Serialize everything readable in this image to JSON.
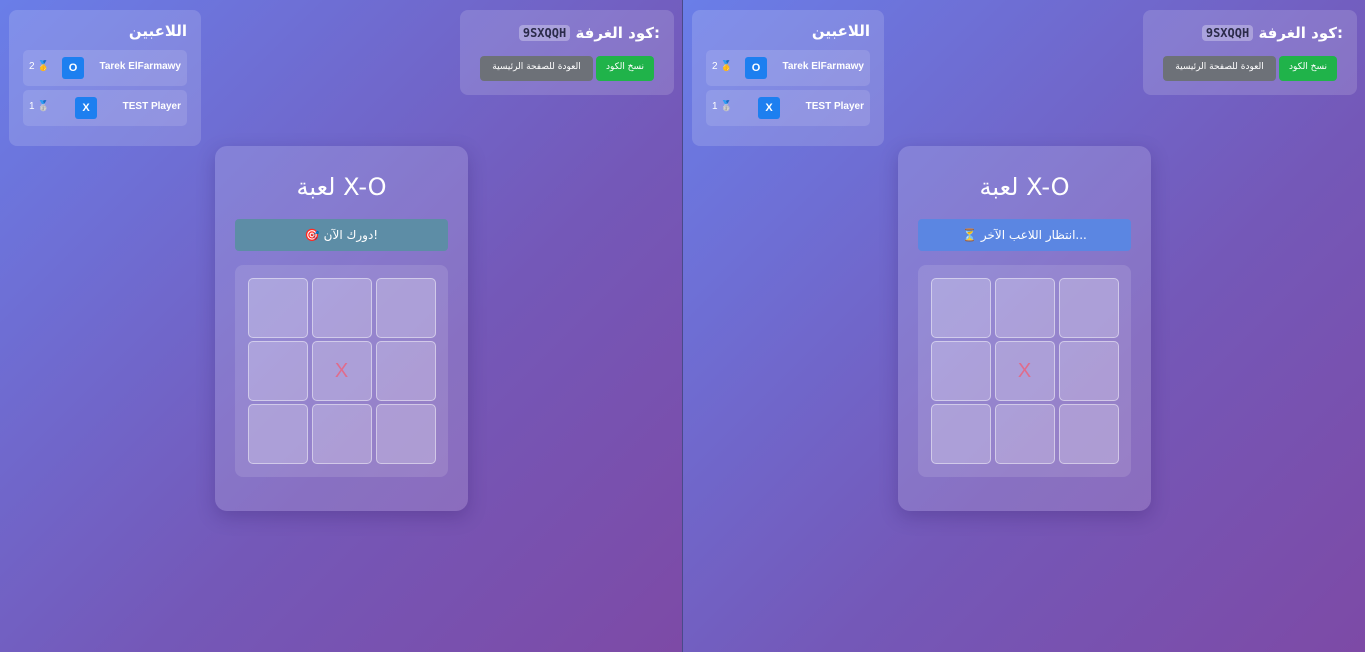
{
  "panes": [
    {
      "players": {
        "title": "اللاعبين",
        "list": [
          {
            "name": "Tarek ElFarmawy",
            "symbol": "O",
            "score": "2 🥇"
          },
          {
            "name": "TEST Player",
            "symbol": "X",
            "score": "1 🥈"
          }
        ]
      },
      "room": {
        "label": "كود الغرفة:",
        "code": "9SXQQH",
        "copy_label": "نسخ الكود",
        "home_label": "العودة للصفحة الرئيسية"
      },
      "game": {
        "title": "لعبة X-O",
        "status": "🎯 دورك الآن!",
        "board": [
          "",
          "",
          "",
          "",
          "X",
          "",
          "",
          "",
          ""
        ]
      }
    },
    {
      "players": {
        "title": "اللاعبين",
        "list": [
          {
            "name": "Tarek ElFarmawy",
            "symbol": "O",
            "score": "2 🥇"
          },
          {
            "name": "TEST Player",
            "symbol": "X",
            "score": "1 🥈"
          }
        ]
      },
      "room": {
        "label": "كود الغرفة:",
        "code": "9SXQQH",
        "copy_label": "نسخ الكود",
        "home_label": "العودة للصفحة الرئيسية"
      },
      "game": {
        "title": "لعبة X-O",
        "status": "⏳ انتظار اللاعب الآخر...",
        "board": [
          "",
          "",
          "",
          "",
          "X",
          "",
          "",
          "",
          ""
        ]
      }
    }
  ],
  "colors": {
    "accent_blue": "#1d7ff0",
    "copy_green": "#20b34a",
    "x_color": "#e06c8c"
  }
}
